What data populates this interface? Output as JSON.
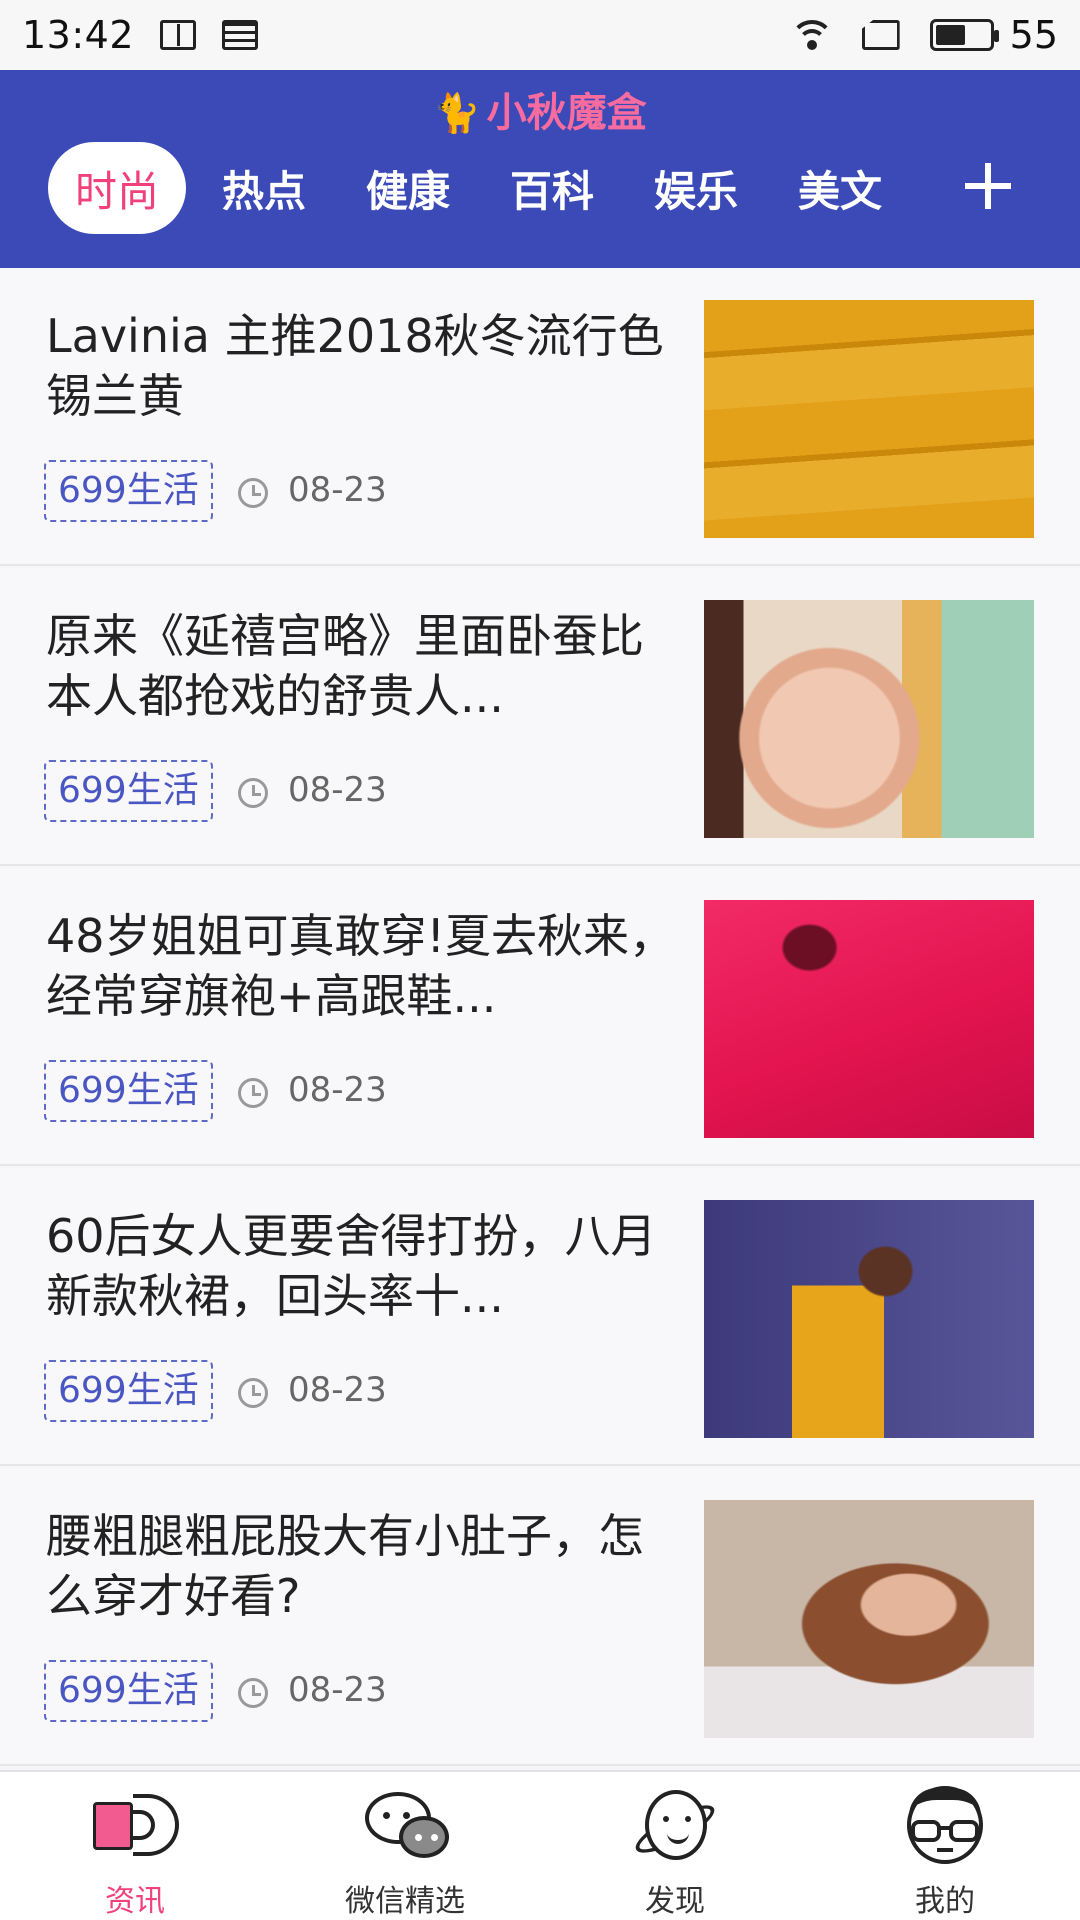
{
  "status_bar": {
    "time": "13:42",
    "battery_level": 55,
    "battery_text": "55"
  },
  "header": {
    "logo_text": "小秋魔盒",
    "background_color": "#3b4ab7",
    "accent_color": "#f0417a",
    "tabs": [
      {
        "label": "时尚",
        "active": true
      },
      {
        "label": "热点",
        "active": false
      },
      {
        "label": "健康",
        "active": false
      },
      {
        "label": "百科",
        "active": false
      },
      {
        "label": "娱乐",
        "active": false
      },
      {
        "label": "美文",
        "active": false
      }
    ],
    "add_tab_icon": "plus-icon"
  },
  "feed": {
    "articles": [
      {
        "title": "Lavinia 主推2018秋冬流行色锡兰黄",
        "source": "699生活",
        "date": "08-23",
        "thumbnail": "mustard-fabric"
      },
      {
        "title": "原来《延禧宫略》里面卧蚕比本人都抢戏的舒贵人...",
        "source": "699生活",
        "date": "08-23",
        "thumbnail": "actress-portrait"
      },
      {
        "title": "48岁姐姐可真敢穿!夏去秋来，经常穿旗袍+高跟鞋...",
        "source": "699生活",
        "date": "08-23",
        "thumbnail": "red-qipao"
      },
      {
        "title": "60后女人更要舍得打扮，八月新款秋裙，回头率十...",
        "source": "699生活",
        "date": "08-23",
        "thumbnail": "yellow-dress"
      },
      {
        "title": "腰粗腿粗屁股大有小肚子，怎么穿才好看?",
        "source": "699生活",
        "date": "08-23",
        "thumbnail": "woman-on-swing"
      }
    ]
  },
  "bottom_nav": {
    "items": [
      {
        "label": "资讯",
        "icon": "speaker-icon",
        "active": true
      },
      {
        "label": "微信精选",
        "icon": "wechat-icon",
        "active": false
      },
      {
        "label": "发现",
        "icon": "planet-icon",
        "active": false
      },
      {
        "label": "我的",
        "icon": "face-glasses-icon",
        "active": false
      }
    ]
  }
}
